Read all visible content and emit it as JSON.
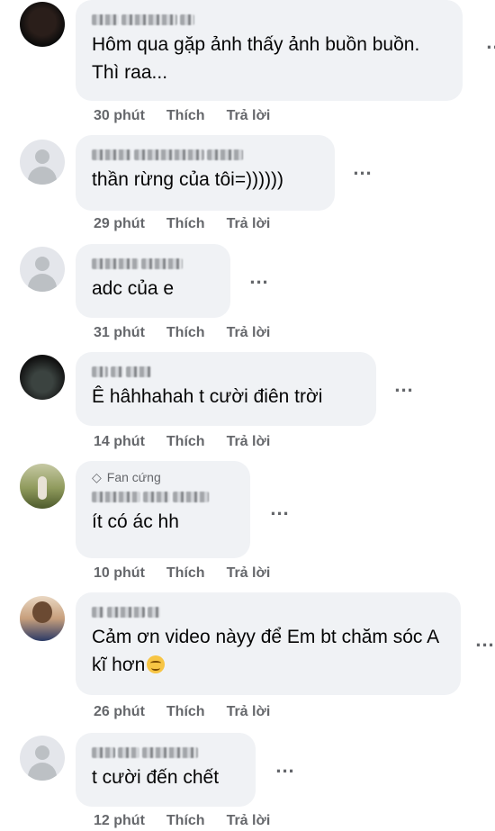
{
  "comments": [
    {
      "text": "Hôm qua gặp ảnh thấy ảnh buồn buồn. Thì raa...",
      "time": "30 phút",
      "like": "Thích",
      "reply": "Trả lời",
      "avatar": "photo-dark"
    },
    {
      "text": "thần rừng của tôi=))))))",
      "time": "29 phút",
      "like": "Thích",
      "reply": "Trả lời",
      "avatar": "default"
    },
    {
      "text": "adc của e",
      "time": "31 phút",
      "like": "Thích",
      "reply": "Trả lời",
      "avatar": "default"
    },
    {
      "text": "Ê hâhhahah t cười điên trời",
      "time": "14 phút",
      "like": "Thích",
      "reply": "Trả lời",
      "avatar": "photo-night"
    },
    {
      "badge": "Fan cứng",
      "text": "ít có ác hh",
      "time": "10 phút",
      "like": "Thích",
      "reply": "Trả lời",
      "avatar": "photo-field"
    },
    {
      "text": "Cảm ơn video nàyy để Em bt chăm sóc A kĩ hơn",
      "emoji": "relieved-face",
      "time": "26 phút",
      "like": "Thích",
      "reply": "Trả lời",
      "avatar": "photo-girl"
    },
    {
      "text": "t cười đến chết",
      "time": "12 phút",
      "like": "Thích",
      "reply": "Trả lời",
      "avatar": "default"
    }
  ],
  "more_label": "...",
  "colors": {
    "bubble": "#f0f2f5",
    "meta": "#65676b",
    "text": "#050505"
  }
}
